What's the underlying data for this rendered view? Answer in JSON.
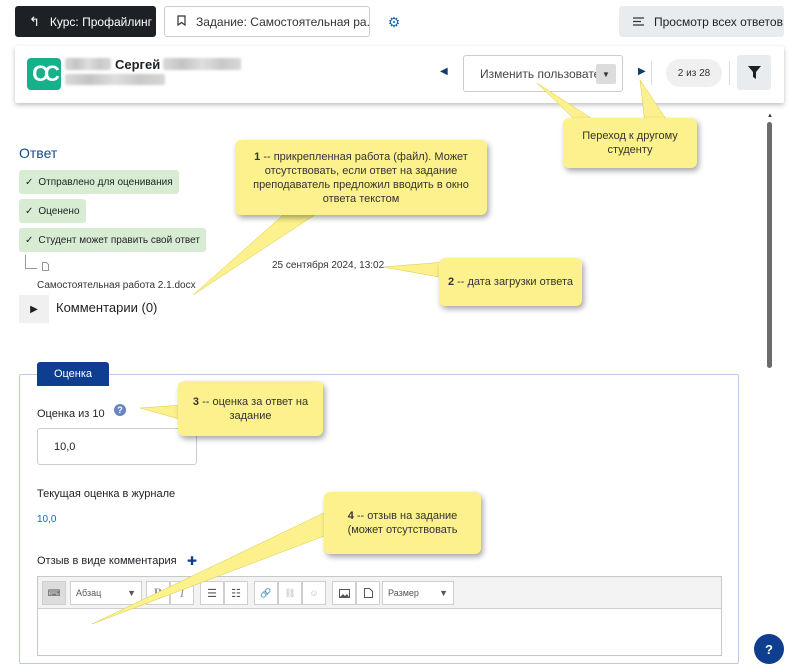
{
  "topbar": {
    "course_label": "Курс: Профайлинг",
    "task_label": "Задание: Самостоятельная ра...",
    "all_label": "Просмотр всех ответов"
  },
  "user": {
    "name": "Сергей",
    "select_text": "Изменить пользовате",
    "counter": "2 из 28",
    "avatar_initials": "CC"
  },
  "answer": {
    "heading": "Ответ",
    "badges": [
      "Отправлено для оценивания",
      "Оценено",
      "Студент может править свой ответ"
    ],
    "file_name": "Самостоятельная работа 2.1.docx",
    "file_date": "25 сентября 2024, 13:02",
    "comments_label": "Комментарии (0)"
  },
  "grade": {
    "tab_label": "Оценка",
    "grade_label": "Оценка из 10",
    "grade_value": "10,0",
    "current_label": "Текущая оценка в журнале",
    "current_value": "10,0",
    "feedback_label": "Отзыв в виде комментария"
  },
  "editor": {
    "format_value": "Абзац",
    "size_value": "Размер"
  },
  "callouts": {
    "c1": {
      "num": "1",
      "text": " -- прикрепленная работа (файл). Может отсутствовать, если ответ на задание преподаватель предложил вводить в окно ответа текстом"
    },
    "c2": {
      "num": "2",
      "text": " -- дата загрузки ответа"
    },
    "c3": {
      "num": "3",
      "text": " -- оценка за ответ на задание"
    },
    "c4": {
      "num": "4",
      "text": " -- отзыв на задание (может отсутствовать"
    },
    "c5": {
      "text": "Переход к другому студенту"
    }
  },
  "icons": {
    "back": "arrow-left-icon",
    "bookmark": "bookmark-icon",
    "gear": "gear-icon",
    "list": "list-icon",
    "filter": "filter-icon",
    "help": "help-icon"
  }
}
